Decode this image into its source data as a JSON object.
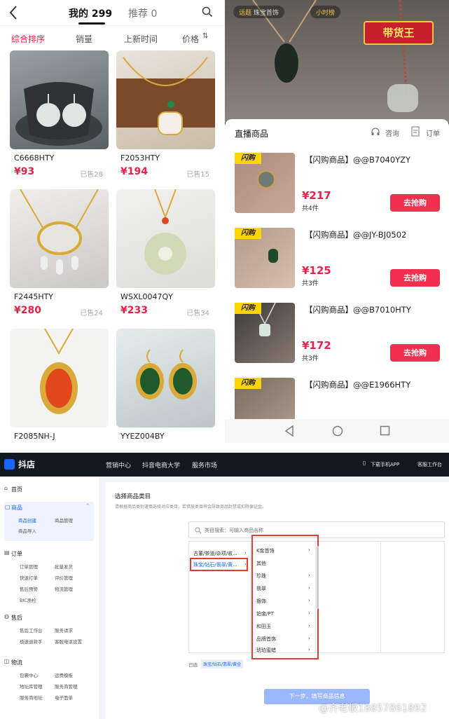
{
  "left": {
    "tabs": [
      "我的 299",
      "推荐 0"
    ],
    "sort": [
      "综合排序",
      "销量",
      "上新时间",
      "价格"
    ],
    "products": [
      {
        "code": "C6668HTY",
        "price": "¥93",
        "sold": "已售28"
      },
      {
        "code": "F2053HTY",
        "price": "¥194",
        "sold": "已售15"
      },
      {
        "code": "F2445HTY",
        "price": "¥280",
        "sold": "已售24"
      },
      {
        "code": "WSXL0047QY",
        "price": "¥233",
        "sold": "已售34"
      },
      {
        "code": "F2085NH-J",
        "price": "",
        "sold": ""
      },
      {
        "code": "YYEZ004BY",
        "price": "",
        "sold": ""
      }
    ]
  },
  "right": {
    "pills": [
      "话题",
      "珠宝首饰",
      "小时榜"
    ],
    "banner": "带货王",
    "sheet_title": "直播商品",
    "consult": "咨询",
    "orders": "订单",
    "items": [
      {
        "title": "【闪购商品】@@B7040YZY",
        "price": "¥217",
        "count": "共4件",
        "btn": "去抢购",
        "badge": "闪购"
      },
      {
        "title": "【闪购商品】@@JY-BJ0502",
        "price": "¥125",
        "count": "共3件",
        "btn": "去抢购",
        "badge": "闪购"
      },
      {
        "title": "【闪购商品】@@B7010HTY",
        "price": "¥172",
        "count": "共3件",
        "btn": "去抢购",
        "badge": "闪购"
      },
      {
        "title": "【闪购商品】@@E1966HTY",
        "price": "",
        "count": "",
        "btn": "",
        "badge": "闪购"
      }
    ]
  },
  "web": {
    "logo": "抖店",
    "nav": [
      "营销中心",
      "抖音电商大学",
      "服务市场"
    ],
    "download": "下载手机APP",
    "workspace": "客服工作台",
    "sidebar": {
      "home": "首页",
      "goods": "商品",
      "goods_subs": [
        "商品创建",
        "商品管理",
        "商品导入"
      ],
      "order": "订单",
      "order_subs": [
        "订单管理",
        "批量发货",
        "快速打单",
        "评价管理",
        "售后预警",
        "物流管理",
        "BIC质检"
      ],
      "after": "售后",
      "after_subs": [
        "售后工作台",
        "服务请求",
        "极速退款手",
        "客服电话设置"
      ],
      "logistics": "物流",
      "logistics_subs": [
        "包裹中心",
        "运费模板",
        "地址库管理",
        "服务商管理",
        "服务商地址",
        "电子面单"
      ]
    },
    "main": {
      "title": "选择商品类目",
      "hint": "请根据商品类别谨慎选择对应类目，若错放类目将会导致商品封禁或扣除保证金。",
      "search_placeholder": "类目搜索：可输入商品名称",
      "col1": [
        "古董/茶道/杂项/收...",
        "珠宝/钻石/翡翠/黄..."
      ],
      "col2": [
        "K金首饰",
        "其他",
        "珍珠",
        "翡翠",
        "银饰",
        "铂金/PT",
        "和田玉",
        "品牌首饰",
        "琥珀蜜蜡"
      ],
      "selected_label": "已选",
      "selected_value": "珠宝/钻石/翡翠/黄金",
      "next_btn": "下一步，填写商品信息"
    },
    "watermark": "@齐老板18857861892"
  }
}
